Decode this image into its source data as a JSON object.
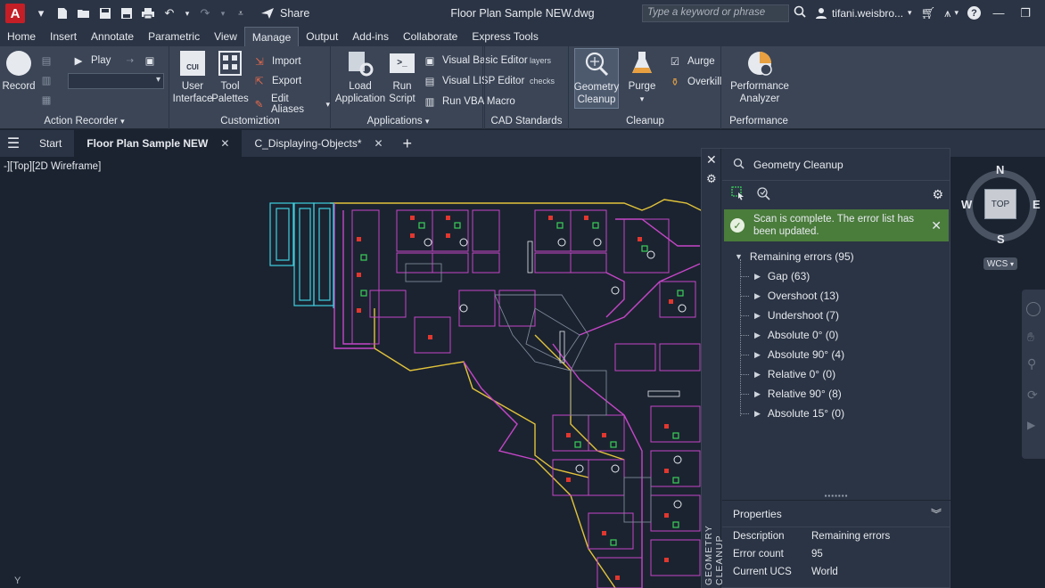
{
  "titlebar": {
    "app_letter": "A",
    "share_label": "Share",
    "window_title": "Floor Plan Sample NEW.dwg",
    "search_placeholder": "Type a keyword or phrase",
    "user_name": "tifani.weisbro..."
  },
  "ribbon_tabs": [
    "Home",
    "Insert",
    "Annotate",
    "Parametric",
    "View",
    "Manage",
    "Output",
    "Add-ins",
    "Collaborate",
    "Express Tools"
  ],
  "active_tab": "Manage",
  "ribbon": {
    "action_recorder": {
      "title": "Action Recorder",
      "record_label": "Record",
      "play_label": "Play"
    },
    "customization": {
      "title": "Customiztion",
      "user_interface_label": "User\nInterface",
      "tool_palettes_label": "Tool\nPalettes",
      "import_label": "Import",
      "export_label": "Export",
      "edit_aliases_label": "Edit Aliases",
      "cui_badge": "CUI"
    },
    "applications": {
      "title": "Applications",
      "load_app_label": "Load\nApplication",
      "run_script_label": "Run\nScript",
      "vba_editor_label": "Visual Basic Editor",
      "lisp_editor_label": "Visual LISP Editor",
      "run_vba_label": "Run VBA Macro"
    },
    "cad_standards": {
      "title": "CAD Standards",
      "layer_label": "layers",
      "check_label": "checks"
    },
    "cleanup": {
      "title": "Cleanup",
      "geometry_cleanup_label": "Geometry\nCleanup",
      "purge_label": "Purge",
      "aurge_label": "Aurge",
      "overkill_label": "Overkill"
    },
    "performance": {
      "title": "Performance",
      "analyzer_label": "Performance\nAnalyzer"
    }
  },
  "doc_tabs": [
    {
      "label": "Start",
      "active": false,
      "closable": false
    },
    {
      "label": "Floor Plan Sample NEW",
      "active": true,
      "closable": true
    },
    {
      "label": "C_Displaying-Objects*",
      "active": false,
      "closable": true
    }
  ],
  "viewport": {
    "view_label": "-][Top][2D Wireframe]",
    "ucs_label": "Y"
  },
  "compass": {
    "n": "N",
    "s": "S",
    "e": "E",
    "w": "W",
    "cube": "TOP",
    "wcs": "WCS"
  },
  "palette": {
    "title": "Geometry Cleanup",
    "vertical_title": "GEOMETRY CLEANUP",
    "banner_text": "Scan is complete. The error list has been updated.",
    "root": "Remaining errors (95)",
    "items": [
      "Gap (63)",
      "Overshoot (13)",
      "Undershoot (7)",
      "Absolute 0° (0)",
      "Absolute 90° (4)",
      "Relative 0° (0)",
      "Relative 90° (8)",
      "Absolute 15° (0)"
    ],
    "properties": {
      "title": "Properties",
      "rows": [
        {
          "key": "Description",
          "value": "Remaining errors"
        },
        {
          "key": "Error count",
          "value": "95"
        },
        {
          "key": "Current UCS",
          "value": "World"
        }
      ]
    }
  },
  "colors": {
    "accent_green": "#4a7c3b",
    "app_red": "#c41e26",
    "drawing_magenta": "#c646c8",
    "drawing_cyan": "#3fd0e0",
    "drawing_yellow": "#e2c33a"
  }
}
